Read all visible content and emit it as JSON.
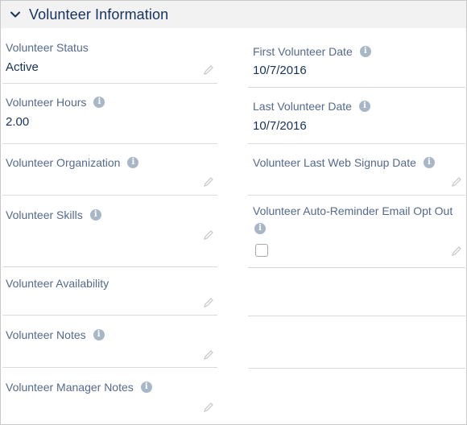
{
  "section": {
    "title": "Volunteer Information"
  },
  "left_fields": [
    {
      "label": "Volunteer Status",
      "value": "Active"
    },
    {
      "label": "Volunteer Hours",
      "value": "2.00"
    },
    {
      "label": "Volunteer Organization",
      "value": ""
    },
    {
      "label": "Volunteer Skills",
      "value": ""
    },
    {
      "label": "Volunteer Availability",
      "value": ""
    },
    {
      "label": "Volunteer Notes",
      "value": ""
    },
    {
      "label": "Volunteer Manager Notes",
      "value": ""
    }
  ],
  "right_fields": [
    {
      "label": "First Volunteer Date",
      "value": "10/7/2016"
    },
    {
      "label": "Last Volunteer Date",
      "value": "10/7/2016"
    },
    {
      "label": "Volunteer Last Web Signup Date",
      "value": ""
    },
    {
      "label": "Volunteer Auto-Reminder Email Opt Out",
      "checked": false
    }
  ],
  "icons": {
    "header_toggle": "chevron-down-icon",
    "info": "info-icon",
    "edit": "pencil-icon"
  },
  "colors": {
    "header_bg": "#f3f2f2",
    "label": "#54698d",
    "value": "#16325c",
    "info_icon": "#a8b7c7",
    "divider": "#dddbda"
  }
}
